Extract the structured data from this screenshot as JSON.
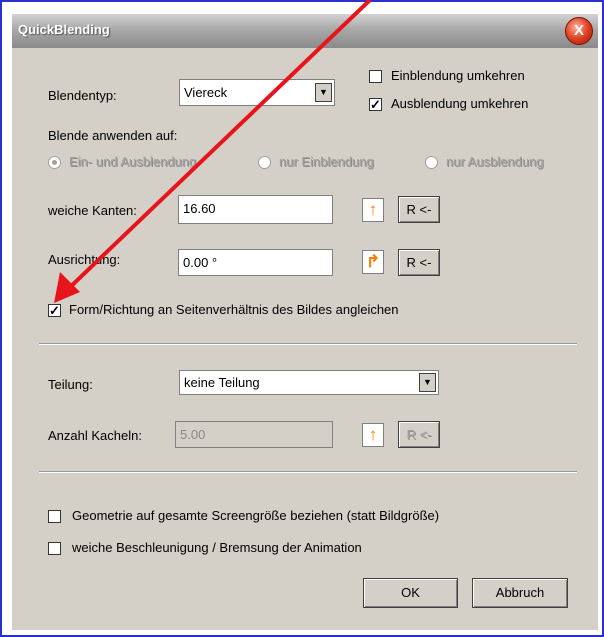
{
  "window": {
    "title": "QuickBlending",
    "close_glyph": "X"
  },
  "blendentyp": {
    "label": "Blendentyp:",
    "value": "Viereck",
    "options_glyph": "▼"
  },
  "checkboxes_top": [
    {
      "label": "Einblendung umkehren",
      "checked": false
    },
    {
      "label": "Ausblendung umkehren",
      "checked": true
    }
  ],
  "apply": {
    "label": "Blende anwenden auf:",
    "options": [
      {
        "label": "Ein- und Ausblendung",
        "selected": true
      },
      {
        "label": "nur Einblendung",
        "selected": false
      },
      {
        "label": "nur Ausblendung",
        "selected": false
      }
    ]
  },
  "soft_edge": {
    "label": "weiche Kanten:",
    "value": "16.60",
    "reset_label": "R <-"
  },
  "orientation": {
    "label": "Ausrichtung:",
    "value": "0.00 °",
    "reset_label": "R <-"
  },
  "aspect_checkbox": {
    "label": "Form/Richtung an Seitenverhältnis des Bildes angleichen",
    "checked": true
  },
  "teilung": {
    "label": "Teilung:",
    "value": "keine Teilung",
    "options_glyph": "▼"
  },
  "kacheln": {
    "label": "Anzahl Kacheln:",
    "value": "5.00",
    "reset_label": "R <-"
  },
  "bottom_checkboxes": [
    {
      "label": "Geometrie auf gesamte Screengröße beziehen (statt Bildgröße)",
      "checked": false
    },
    {
      "label": "weiche Beschleunigung / Bremsung der Animation",
      "checked": false
    }
  ],
  "buttons": {
    "ok": "OK",
    "cancel": "Abbruch"
  },
  "annotation": {
    "arrow_color": "#e8141c"
  }
}
